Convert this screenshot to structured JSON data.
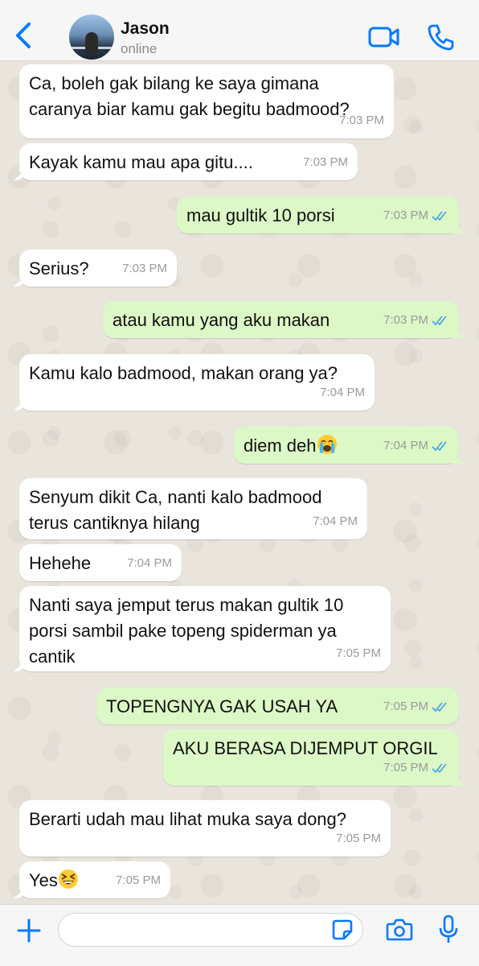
{
  "header": {
    "contact_name": "Jason",
    "status": "online",
    "back_icon": "chevron-left-icon",
    "video_icon": "video-camera-icon",
    "call_icon": "phone-icon"
  },
  "colors": {
    "accent": "#007aff",
    "incoming_bubble": "#ffffff",
    "outgoing_bubble": "#dcf8c6",
    "read_ticks": "#4fa6e8",
    "chat_background": "#e9e4dc"
  },
  "messages": [
    {
      "direction": "in",
      "text": "Ca, boleh gak bilang ke saya gimana\ncaranya biar kamu gak begitu badmood?",
      "time": "7:03 PM"
    },
    {
      "direction": "in",
      "text": "Kayak kamu mau apa gitu....",
      "time": "7:03 PM"
    },
    {
      "direction": "out",
      "text": "mau gultik 10 porsi",
      "time": "7:03 PM",
      "read": true
    },
    {
      "direction": "in",
      "text": "Serius?",
      "time": "7:03 PM"
    },
    {
      "direction": "out",
      "text": "atau kamu yang aku makan",
      "time": "7:03 PM",
      "read": true
    },
    {
      "direction": "in",
      "text": "Kamu kalo badmood, makan orang ya?",
      "time": "7:04 PM"
    },
    {
      "direction": "out",
      "text": "diem deh",
      "emoji": "loudly-crying-face",
      "time": "7:04 PM",
      "read": true
    },
    {
      "direction": "in",
      "text": "Senyum dikit Ca, nanti kalo badmood\nterus cantiknya hilang",
      "time": "7:04 PM"
    },
    {
      "direction": "in",
      "text": "Hehehe",
      "time": "7:04 PM"
    },
    {
      "direction": "in",
      "text": "Nanti saya jemput terus makan gultik 10\nporsi sambil pake topeng spiderman ya\ncantik",
      "time": "7:05 PM"
    },
    {
      "direction": "out",
      "text": "TOPENGNYA GAK USAH YA",
      "time": "7:05 PM",
      "read": true
    },
    {
      "direction": "out",
      "text": "AKU BERASA DIJEMPUT ORGIL",
      "time": "7:05 PM",
      "read": true
    },
    {
      "direction": "in",
      "text": "Berarti udah mau lihat muka saya dong?",
      "time": "7:05 PM"
    },
    {
      "direction": "in",
      "text": "Yes",
      "emoji": "grinning-squinting-face",
      "time": "7:05 PM"
    }
  ],
  "composer": {
    "placeholder": "",
    "plus_icon": "plus-icon",
    "sticker_icon": "sticker-icon",
    "camera_icon": "camera-icon",
    "mic_icon": "microphone-icon"
  }
}
